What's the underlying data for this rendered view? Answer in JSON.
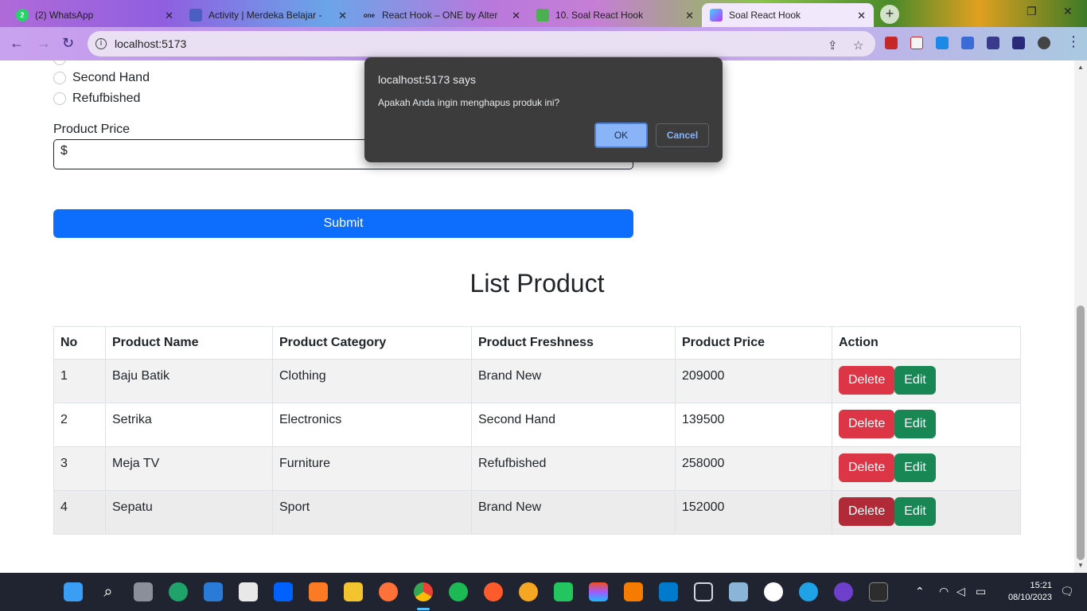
{
  "browser": {
    "tabs": [
      {
        "title": "(2) WhatsApp",
        "icon": "whatsapp-icon",
        "color": "#25d366"
      },
      {
        "title": "Activity | Merdeka Belajar - K",
        "icon": "kampus-merdeka-icon",
        "color": "#4a5fc1"
      },
      {
        "title": "React Hook – ONE by Alterr",
        "icon": "one-icon",
        "color": "#222222"
      },
      {
        "title": "10. Soal React Hook",
        "icon": "book-icon",
        "color": "#4caf50"
      },
      {
        "title": "Soal React Hook",
        "icon": "vite-icon",
        "color": "#bd34fe"
      }
    ],
    "url": "localhost:5173"
  },
  "form": {
    "radio_options": [
      "Second Hand",
      "Refufbished"
    ],
    "price_label": "Product Price",
    "price_value": "$",
    "submit_label": "Submit"
  },
  "list": {
    "title": "List Product",
    "headers": [
      "No",
      "Product Name",
      "Product Category",
      "Product Freshness",
      "Product Price",
      "Action"
    ],
    "rows": [
      {
        "no": "1",
        "name": "Baju Batik",
        "category": "Clothing",
        "freshness": "Brand New",
        "price": "209000"
      },
      {
        "no": "2",
        "name": "Setrika",
        "category": "Electronics",
        "freshness": "Second Hand",
        "price": "139500"
      },
      {
        "no": "3",
        "name": "Meja TV",
        "category": "Furniture",
        "freshness": "Refufbished",
        "price": "258000"
      },
      {
        "no": "4",
        "name": "Sepatu",
        "category": "Sport",
        "freshness": "Brand New",
        "price": "152000"
      }
    ],
    "delete_label": "Delete",
    "edit_label": "Edit"
  },
  "dialog": {
    "origin": "localhost:5173 says",
    "message": "Apakah Anda ingin menghapus produk ini?",
    "ok_label": "OK",
    "cancel_label": "Cancel"
  },
  "taskbar": {
    "time": "15:21",
    "date": "08/10/2023"
  },
  "colors": {
    "primary": "#0d6efd",
    "danger": "#dc3545",
    "success": "#198754"
  }
}
